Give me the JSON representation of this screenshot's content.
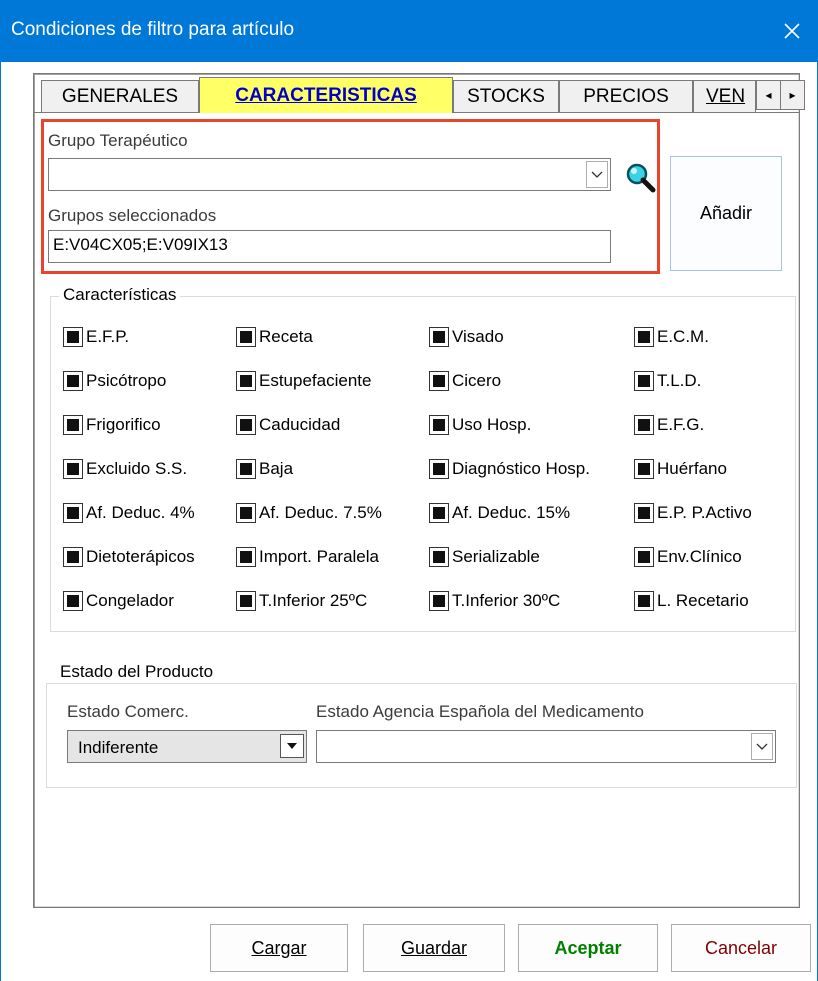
{
  "window": {
    "title": "Condiciones de filtro para artículo",
    "close_glyph": "✕"
  },
  "tabs": [
    {
      "label": "GENERALES",
      "active": false
    },
    {
      "label": "CARACTERISTICAS",
      "active": true
    },
    {
      "label": "STOCKS",
      "active": false
    },
    {
      "label": "PRECIOS",
      "active": false
    },
    {
      "label": "VEN",
      "active": false
    }
  ],
  "tab_scroll": {
    "left": "◂",
    "right": "▸"
  },
  "grupo": {
    "label": "Grupo Terapéutico",
    "value": "",
    "selected_label": "Grupos seleccionados",
    "selected_value": "E:V04CX05;E:V09IX13",
    "search_icon": "search-icon",
    "add_button": "Añadir"
  },
  "caracteristicas": {
    "title": "Características",
    "items": [
      [
        "E.F.P.",
        "Receta",
        "Visado",
        "E.C.M."
      ],
      [
        "Psicótropo",
        "Estupefaciente",
        "Cicero",
        "T.L.D."
      ],
      [
        "Frigorifico",
        "Caducidad",
        "Uso Hosp.",
        "E.F.G."
      ],
      [
        "Excluido S.S.",
        "Baja",
        "Diagnóstico Hosp.",
        "Huérfano"
      ],
      [
        "Af. Deduc. 4%",
        "Af. Deduc. 7.5%",
        "Af. Deduc. 15%",
        "E.P. P.Activo"
      ],
      [
        "Dietoterápicos",
        "Import. Paralela",
        "Serializable",
        "Env.Clínico"
      ],
      [
        "Congelador",
        "T.Inferior 25ºC",
        "T.Inferior 30ºC",
        "L. Recetario"
      ]
    ],
    "state": "indeterminate"
  },
  "estado": {
    "title": "Estado del Producto",
    "comerc_label": "Estado Comerc.",
    "comerc_value": "Indiferente",
    "aemps_label": "Estado Agencia Española del Medicamento",
    "aemps_value": ""
  },
  "buttons": {
    "cargar": "Cargar",
    "guardar": "Guardar",
    "aceptar": "Aceptar",
    "cancelar": "Cancelar"
  },
  "colors": {
    "titlebar": "#0078d7",
    "active_tab_bg": "#ffff66",
    "active_tab_text": "#0000cc",
    "highlight_border": "#e8452c",
    "aceptar_text": "#008000",
    "cancelar_text": "#800000"
  }
}
